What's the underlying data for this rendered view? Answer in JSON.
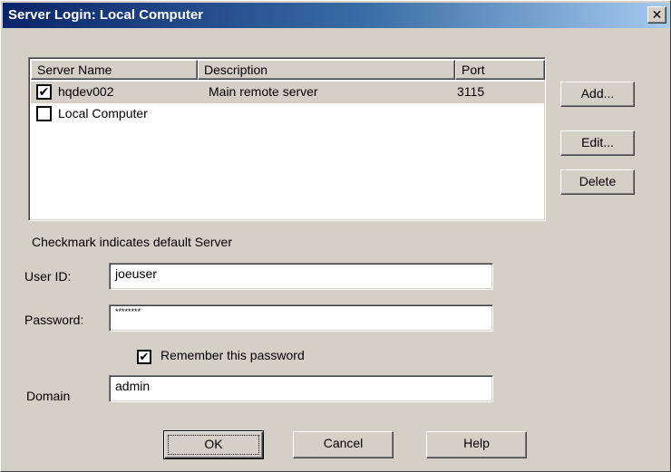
{
  "window": {
    "title": "Server Login: Local Computer",
    "close_glyph": "✕"
  },
  "server_list": {
    "columns": [
      "Server Name",
      "Description",
      "Port"
    ],
    "rows": [
      {
        "checked": true,
        "check_glyph": "✔",
        "name": "hqdev002",
        "description": "Main remote server",
        "port": "3115"
      },
      {
        "checked": false,
        "check_glyph": "",
        "name": "Local Computer",
        "description": "",
        "port": ""
      }
    ]
  },
  "side_buttons": {
    "add": "Add...",
    "edit": "Edit...",
    "delete": "Delete"
  },
  "caption": "Checkmark indicates default Server",
  "form": {
    "user_id_label": "User ID:",
    "user_id_value": "joeuser",
    "password_label": "Password:",
    "password_value": "********",
    "remember_checked": true,
    "remember_glyph": "✔",
    "remember_label": "Remember this password",
    "domain_label": "Domain",
    "domain_value": "admin"
  },
  "footer_buttons": {
    "ok": "OK",
    "cancel": "Cancel",
    "help": "Help"
  },
  "colors": {
    "titlebar_start": "#0a246a",
    "titlebar_end": "#a6caf0",
    "dialog_face": "#d4d0c8",
    "selected_row": "#d4d0c8"
  }
}
